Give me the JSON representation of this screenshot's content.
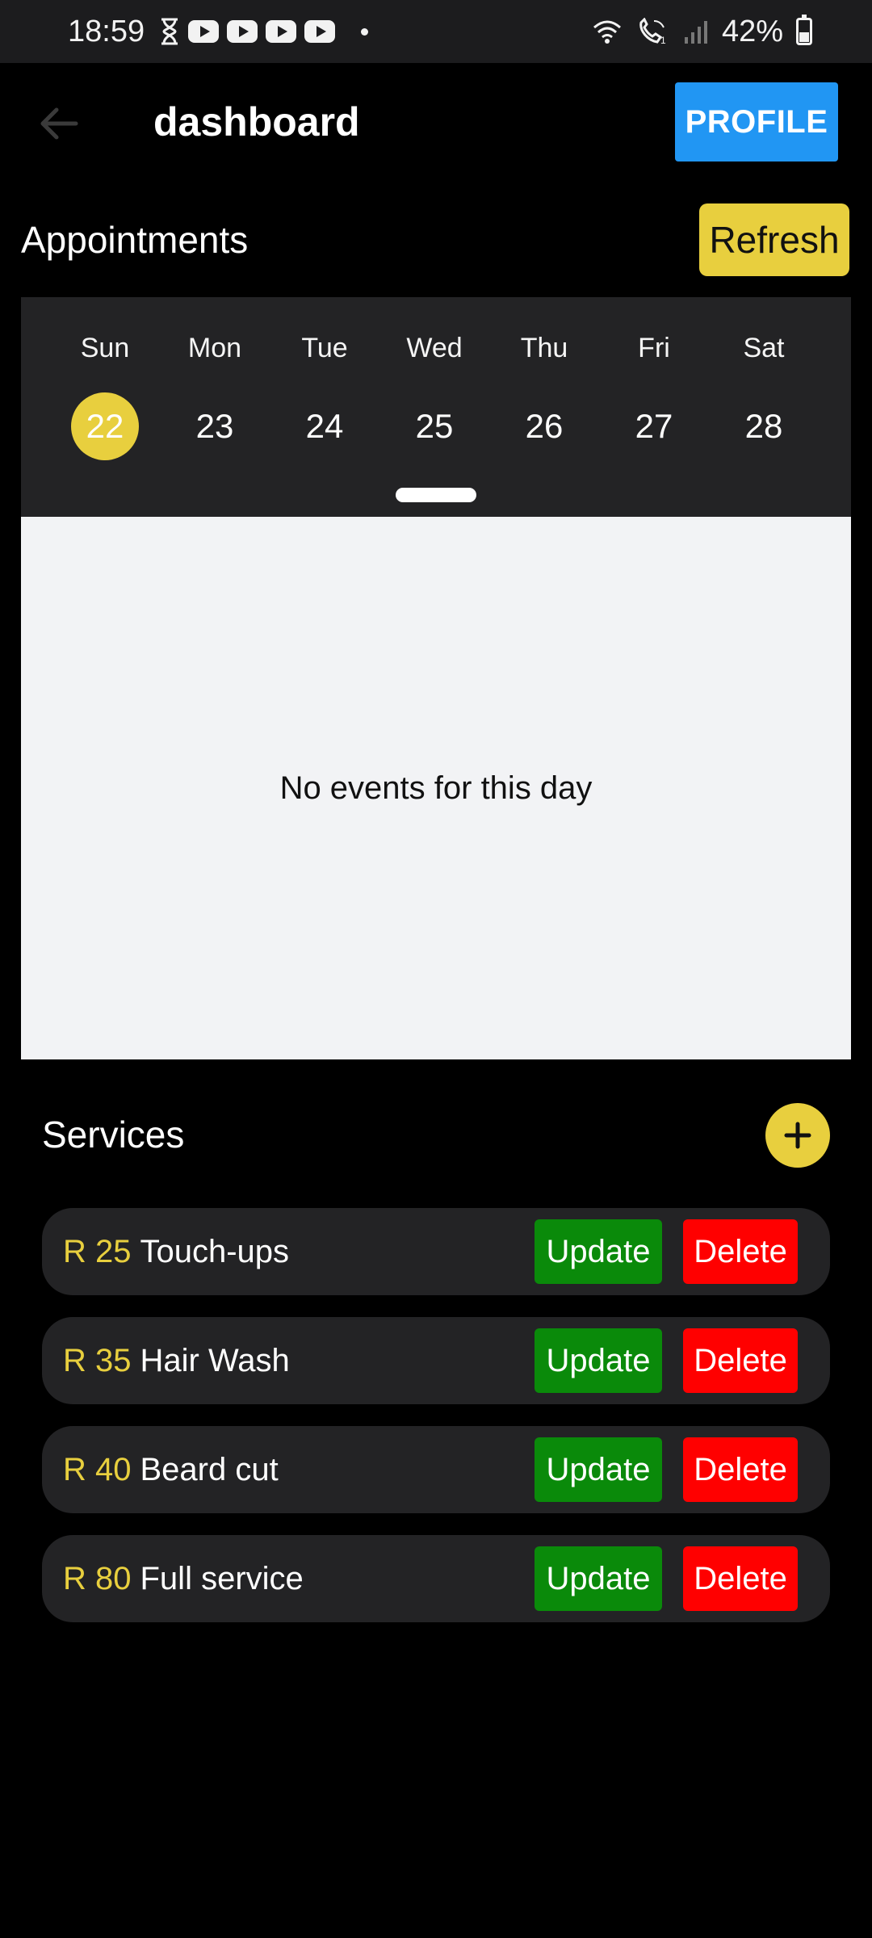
{
  "status_bar": {
    "time": "18:59",
    "battery": "42%",
    "icons": [
      "hourglass-icon",
      "youtube-icon",
      "youtube-icon",
      "youtube-icon",
      "youtube-icon",
      "dot-icon",
      "wifi-icon",
      "wifi-call-icon",
      "signal-icon",
      "battery-icon"
    ]
  },
  "app_bar": {
    "title": "dashboard",
    "profile_label": "PROFILE",
    "back_icon": "arrow-left-icon"
  },
  "appointments": {
    "title": "Appointments",
    "refresh_label": "Refresh",
    "weekdays": [
      "Sun",
      "Mon",
      "Tue",
      "Wed",
      "Thu",
      "Fri",
      "Sat"
    ],
    "dates": [
      "22",
      "23",
      "24",
      "25",
      "26",
      "27",
      "28"
    ],
    "selected_date": "22",
    "empty_text": "No events for this day"
  },
  "services": {
    "title": "Services",
    "add_icon": "plus-icon",
    "update_label": "Update",
    "delete_label": "Delete",
    "items": [
      {
        "price": "R 25",
        "name": "Touch-ups"
      },
      {
        "price": "R 35",
        "name": "Hair Wash"
      },
      {
        "price": "R 40",
        "name": "Beard cut"
      },
      {
        "price": "R 80",
        "name": "Full service"
      }
    ]
  },
  "colors": {
    "accent_yellow": "#e8cf3e",
    "profile_blue": "#2196f3",
    "update_green": "#0a8a0a",
    "delete_red": "#ff0000",
    "card_dark": "#232325",
    "events_bg": "#f2f3f5"
  }
}
